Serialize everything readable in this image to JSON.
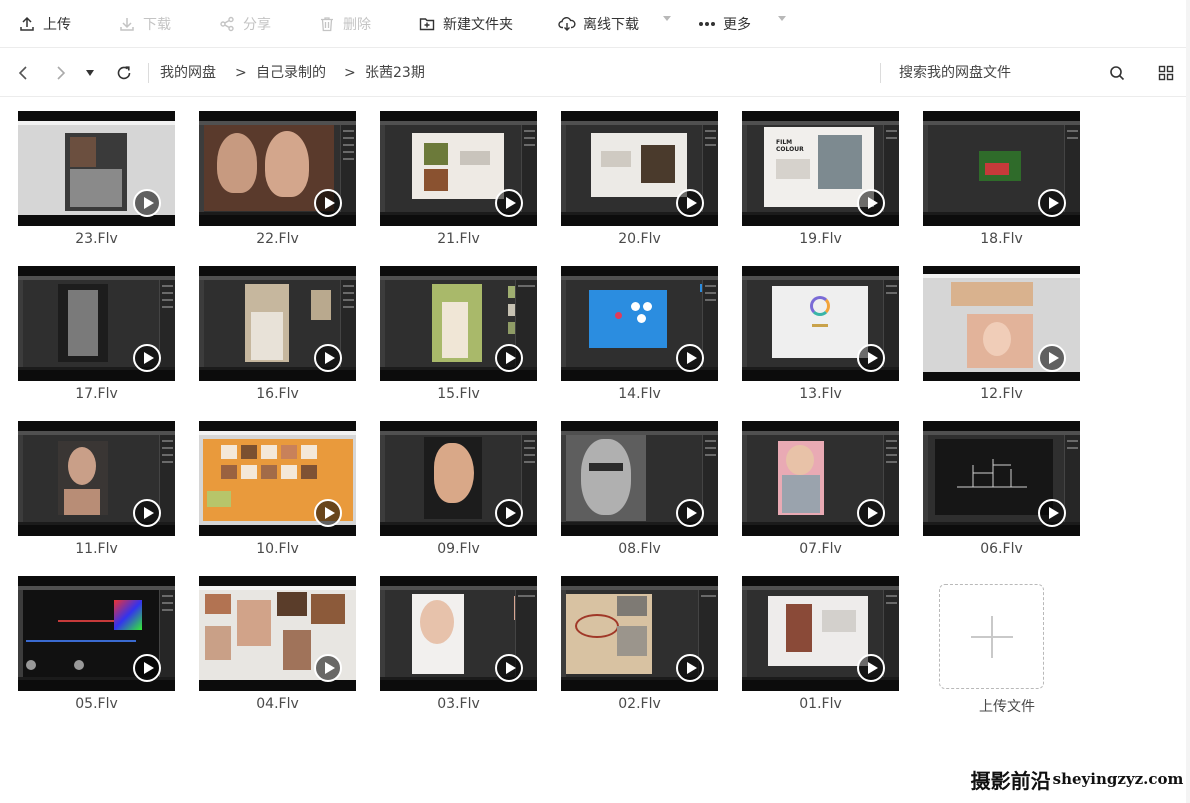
{
  "toolbar": {
    "upload": "上传",
    "download": "下载",
    "share": "分享",
    "delete": "删除",
    "new_folder": "新建文件夹",
    "offline_download": "离线下载",
    "more": "更多"
  },
  "breadcrumb": {
    "items": [
      "我的网盘",
      "自己录制的",
      "张茜23期"
    ],
    "separator": ">"
  },
  "search": {
    "placeholder": "搜索我的网盘文件"
  },
  "files": [
    {
      "name": "23.Flv"
    },
    {
      "name": "22.Flv"
    },
    {
      "name": "21.Flv"
    },
    {
      "name": "20.Flv"
    },
    {
      "name": "19.Flv"
    },
    {
      "name": "18.Flv"
    },
    {
      "name": "17.Flv"
    },
    {
      "name": "16.Flv"
    },
    {
      "name": "15.Flv"
    },
    {
      "name": "14.Flv"
    },
    {
      "name": "13.Flv"
    },
    {
      "name": "12.Flv"
    },
    {
      "name": "11.Flv"
    },
    {
      "name": "10.Flv"
    },
    {
      "name": "09.Flv"
    },
    {
      "name": "08.Flv"
    },
    {
      "name": "07.Flv"
    },
    {
      "name": "06.Flv"
    },
    {
      "name": "05.Flv"
    },
    {
      "name": "04.Flv"
    },
    {
      "name": "03.Flv"
    },
    {
      "name": "02.Flv"
    },
    {
      "name": "01.Flv"
    }
  ],
  "thumb_text": {
    "film_colour": "FILM\nCOLOUR"
  },
  "upload_tile": {
    "label": "上传文件"
  },
  "watermark": {
    "main": "摄影前沿",
    "url": "sheyingzyz.com"
  },
  "colors": {
    "toolbar_text": "#333333",
    "disabled_text": "#c4c4c4",
    "border": "#ececec"
  }
}
